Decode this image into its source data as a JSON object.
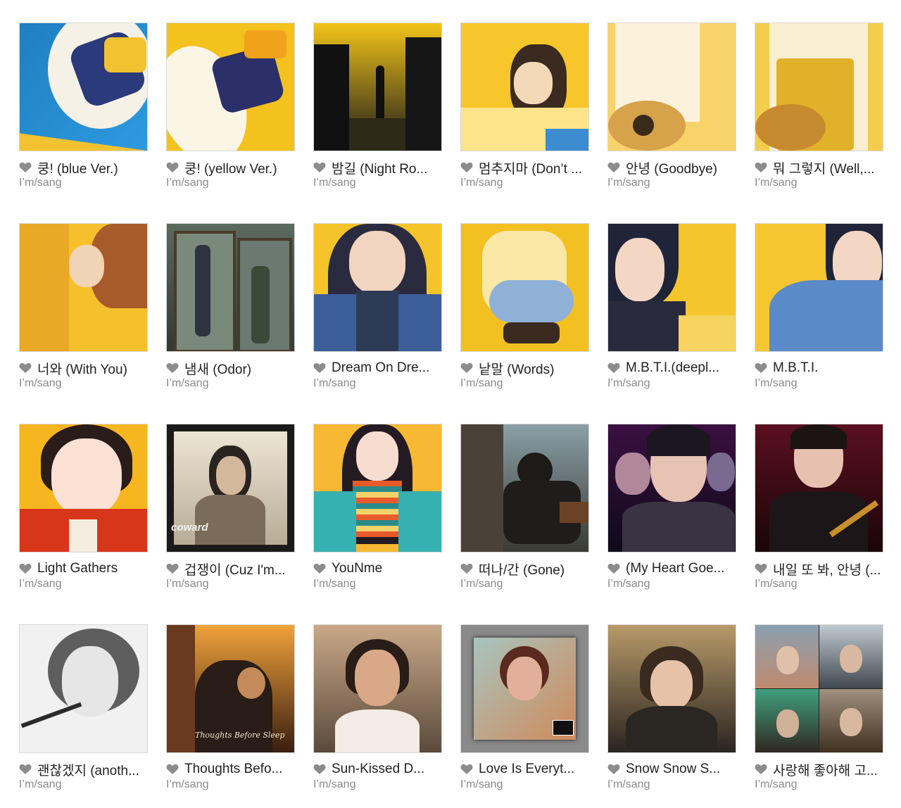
{
  "heart_color": "#8c8c8c",
  "albums": [
    {
      "title": "쿵! (blue Ver.)",
      "artist": "I’m/sang",
      "cover": "blue-anime"
    },
    {
      "title": "쿵! (yellow Ver.)",
      "artist": "I’m/sang",
      "cover": "yellow-whale"
    },
    {
      "title": "밤길 (Night Ro...",
      "artist": "I’m/sang",
      "cover": "night-street"
    },
    {
      "title": "멈추지마 (Don’t ...",
      "artist": "I’m/sang",
      "cover": "yellow-hand"
    },
    {
      "title": "안녕 (Goodbye)",
      "artist": "I’m/sang",
      "cover": "guitar-girl"
    },
    {
      "title": "뭐 그렇지 (Well,...",
      "artist": "I’m/sang",
      "cover": "guitar-overalls"
    },
    {
      "title": "너와 (With You)",
      "artist": "I’m/sang",
      "cover": "couple-yellow"
    },
    {
      "title": "냄새 (Odor)",
      "artist": "I’m/sang",
      "cover": "doorway"
    },
    {
      "title": "Dream On Dre...",
      "artist": "I’m/sang",
      "cover": "girl-headphones"
    },
    {
      "title": "낱말 (Words)",
      "artist": "I’m/sang",
      "cover": "crouching"
    },
    {
      "title": "M.B.T.I.(deepl...",
      "artist": "I’m/sang",
      "cover": "girl-bob"
    },
    {
      "title": "M.B.T.I.",
      "artist": "I’m/sang",
      "cover": "girl-hoodie"
    },
    {
      "title": "Light Gathers",
      "artist": "I’m/sang",
      "cover": "girl-red-jacket"
    },
    {
      "title": "겁쟁이 (Cuz I'm...",
      "artist": "I’m/sang",
      "cover": "coward"
    },
    {
      "title": "YouNme",
      "artist": "I’m/sang",
      "cover": "striped-girl"
    },
    {
      "title": "떠나/간 (Gone)",
      "artist": "I’m/sang",
      "cover": "bench-man"
    },
    {
      "title": "(My Heart Goe...",
      "artist": "I’m/sang",
      "cover": "neon-trio"
    },
    {
      "title": "내일 또 봐, 안녕 (...",
      "artist": "I’m/sang",
      "cover": "neon-guitar"
    },
    {
      "title": "괜찮겠지 (anoth...",
      "artist": "I’m/sang",
      "cover": "sketch"
    },
    {
      "title": "Thoughts Befo...",
      "artist": "I’m/sang",
      "cover": "sunset-couple"
    },
    {
      "title": "Sun-Kissed D...",
      "artist": "I’m/sang",
      "cover": "sun-portrait"
    },
    {
      "title": "Love Is Everyt...",
      "artist": "I’m/sang",
      "cover": "framed-portrait"
    },
    {
      "title": "Snow Snow S...",
      "artist": "I’m/sang",
      "cover": "snow-girl"
    },
    {
      "title": "사랑해 좋아해 고...",
      "artist": "I’m/sang",
      "cover": "four-grid"
    }
  ],
  "cover_texts": {
    "coward": "coward",
    "sunset": "Thoughts Before Sleep"
  }
}
